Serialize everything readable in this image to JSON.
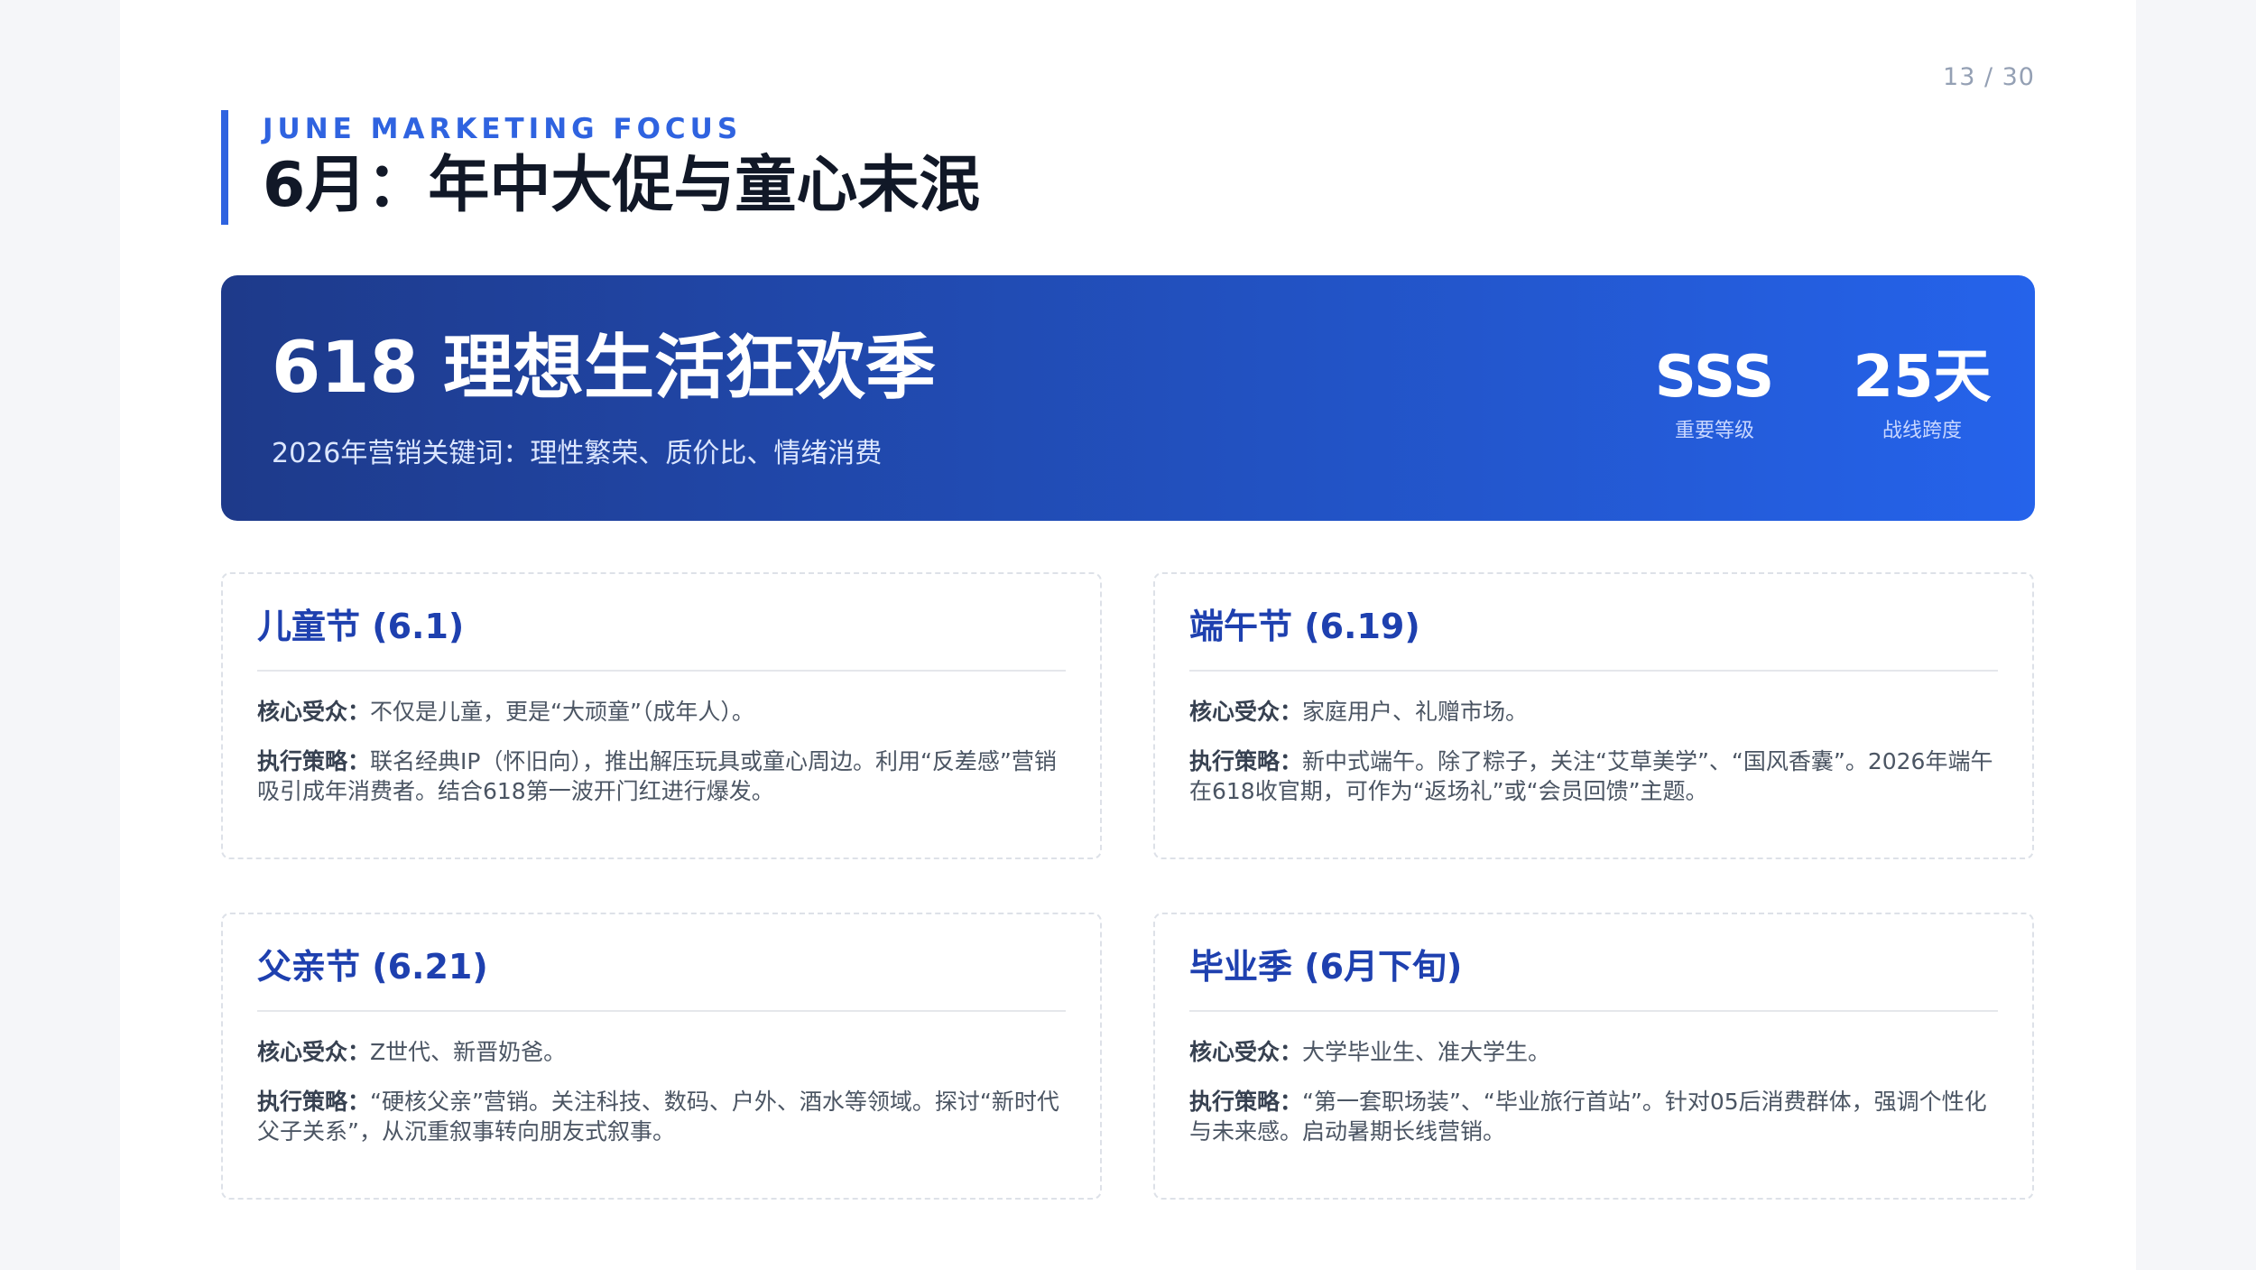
{
  "page": {
    "number": "13 / 30"
  },
  "header": {
    "kicker": "JUNE MARKETING FOCUS",
    "title": "6月：年中大促与童心未泯"
  },
  "banner": {
    "title": "618 理想生活狂欢季",
    "subtitle": "2026年营销关键词：理性繁荣、质价比、情绪消费",
    "stats": [
      {
        "value": "SSS",
        "label": "重要等级"
      },
      {
        "value": "25天",
        "label": "战线跨度"
      }
    ]
  },
  "cards": [
    {
      "title": "儿童节 (6.1)",
      "audience_label": "核心受众：",
      "audience": "不仅是儿童，更是“大顽童”（成年人）。",
      "strategy_label": "执行策略：",
      "strategy": "联名经典IP（怀旧向），推出解压玩具或童心周边。利用“反差感”营销吸引成年消费者。结合618第一波开门红进行爆发。"
    },
    {
      "title": "端午节 (6.19)",
      "audience_label": "核心受众：",
      "audience": "家庭用户、礼赠市场。",
      "strategy_label": "执行策略：",
      "strategy": "新中式端午。除了粽子，关注“艾草美学”、“国风香囊”。2026年端午在618收官期，可作为“返场礼”或“会员回馈”主题。"
    },
    {
      "title": "父亲节 (6.21)",
      "audience_label": "核心受众：",
      "audience": "Z世代、新晋奶爸。",
      "strategy_label": "执行策略：",
      "strategy": "“硬核父亲”营销。关注科技、数码、户外、酒水等领域。探讨“新时代父子关系”，从沉重叙事转向朋友式叙事。"
    },
    {
      "title": "毕业季 (6月下旬)",
      "audience_label": "核心受众：",
      "audience": "大学毕业生、准大学生。",
      "strategy_label": "执行策略：",
      "strategy": "“第一套职场装”、“毕业旅行首站”。针对05后消费群体，强调个性化与未来感。启动暑期长线营销。"
    }
  ],
  "colors": {
    "accent": "#2f63e0",
    "banner_start": "#1e3a8a",
    "banner_end": "#2563eb",
    "card_title": "#1e40af"
  }
}
